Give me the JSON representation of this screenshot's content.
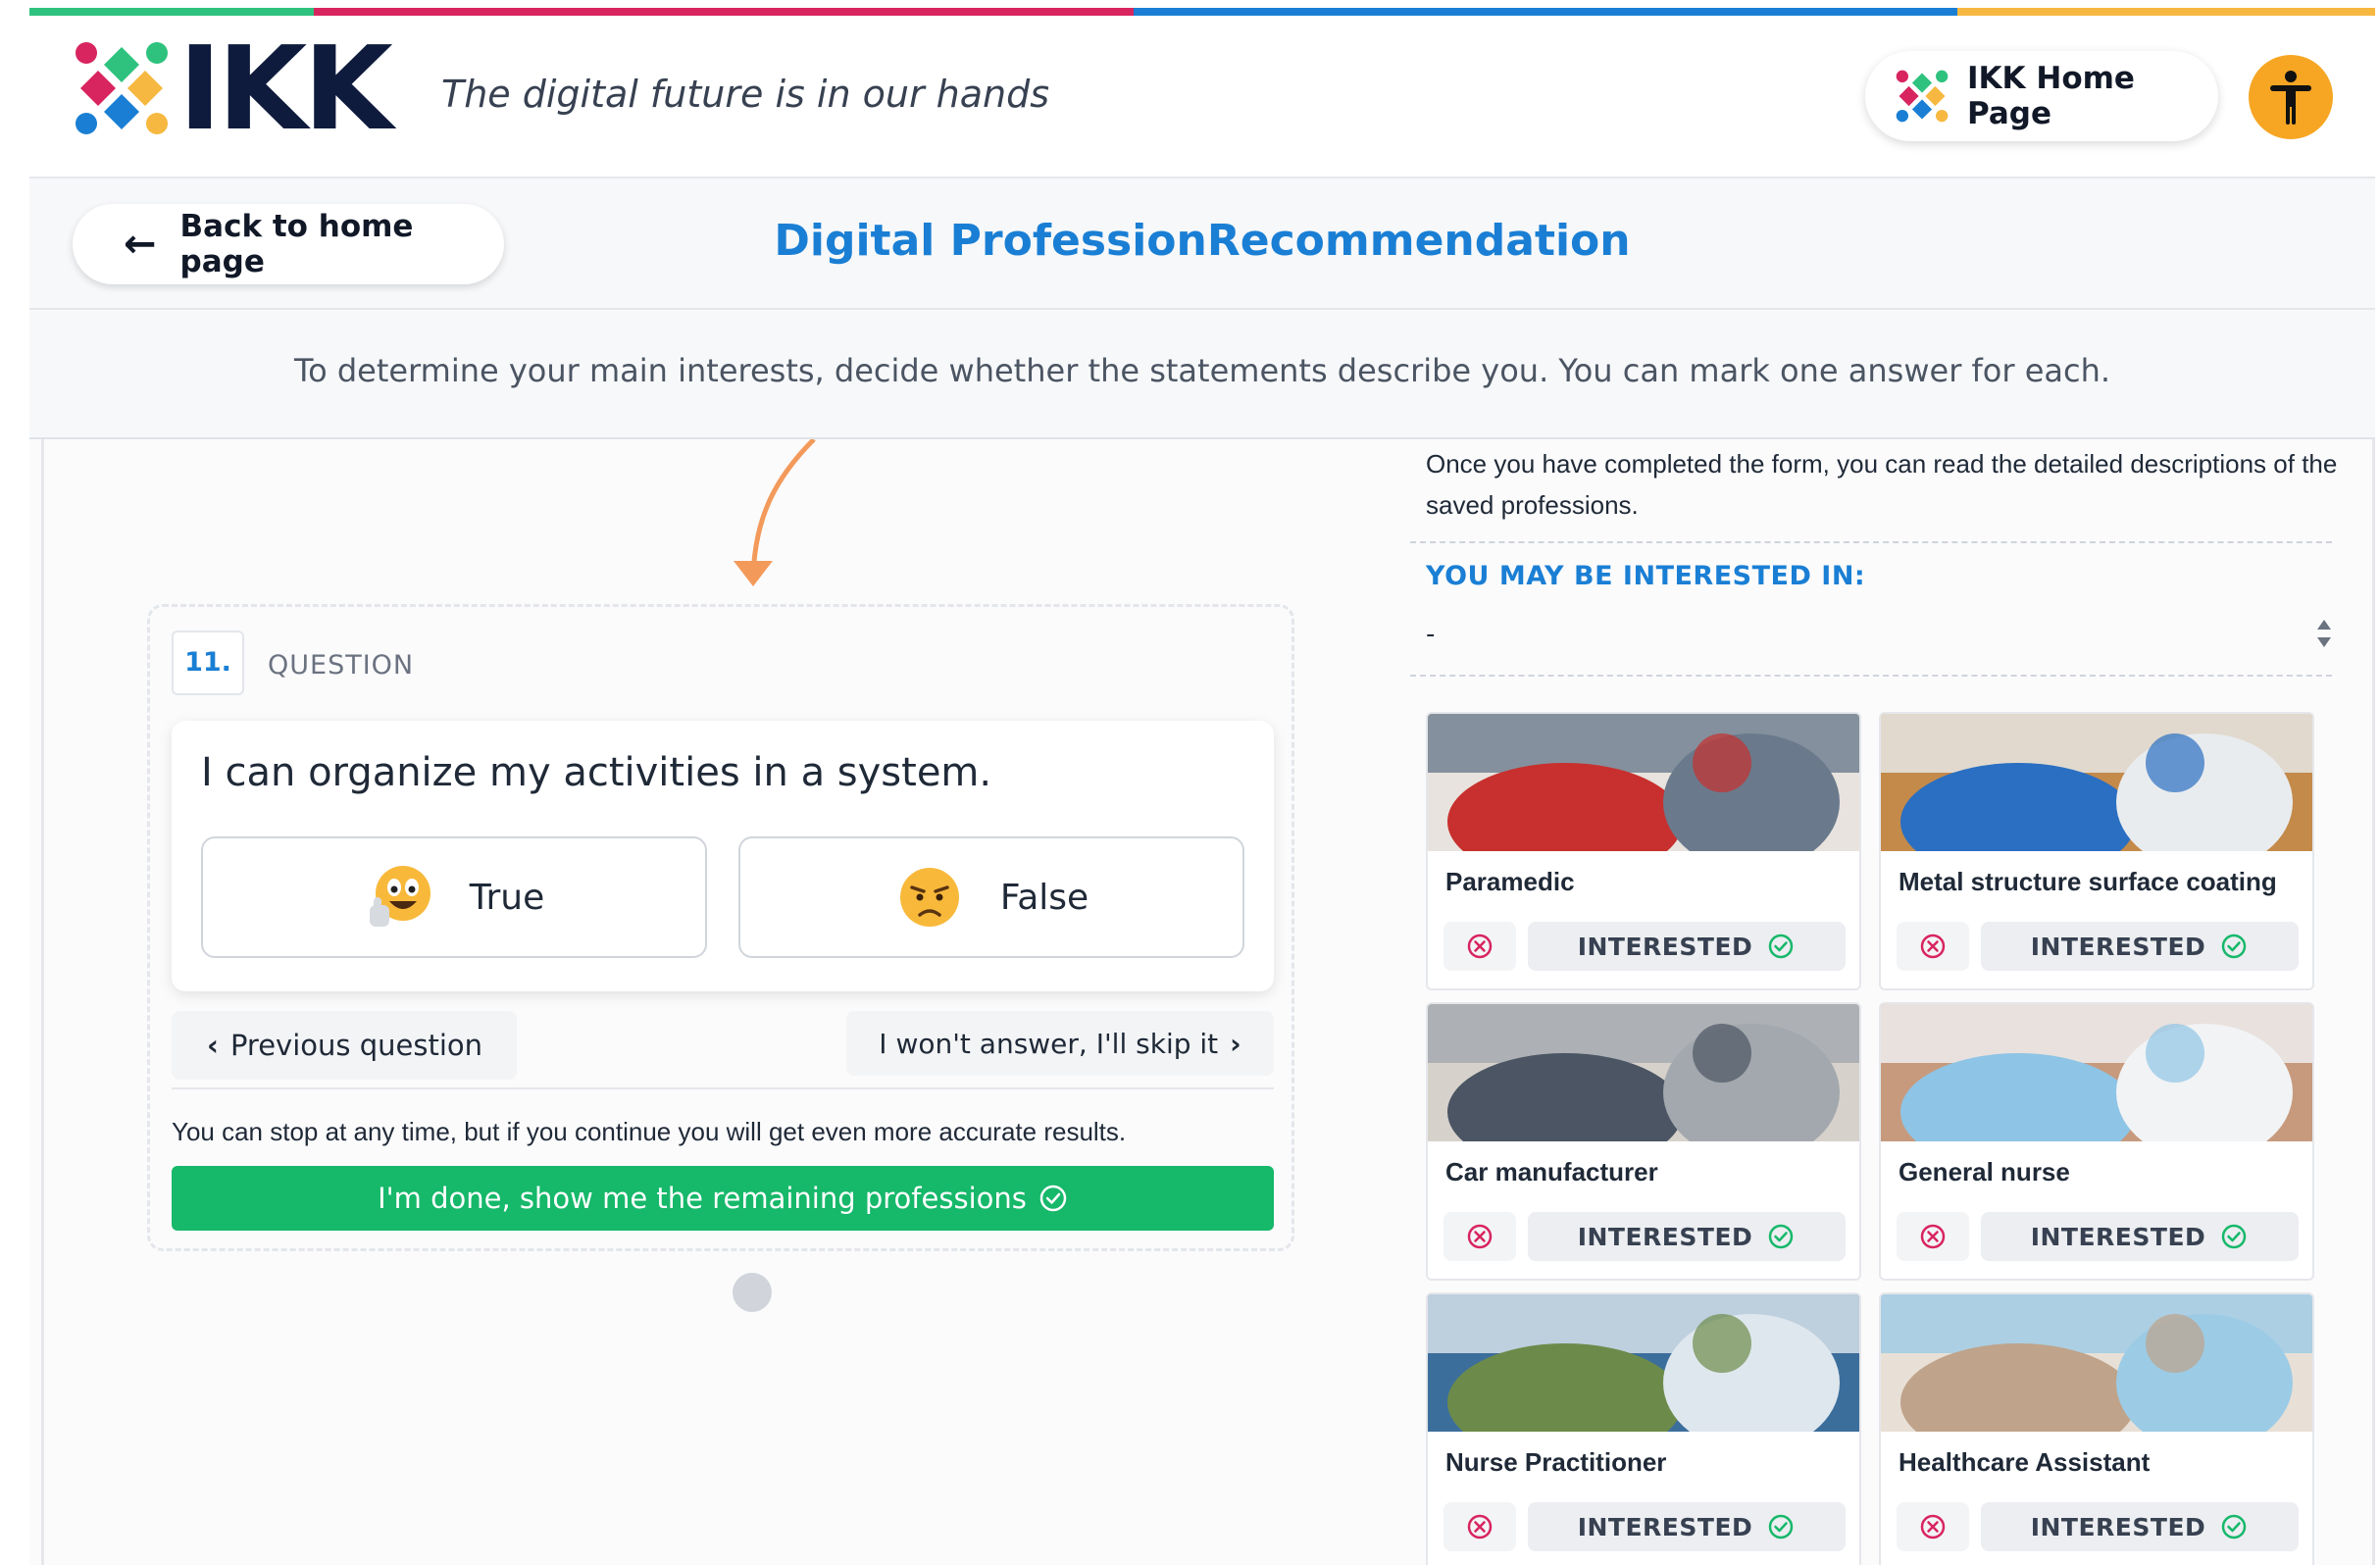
{
  "brand": {
    "name": "IKK",
    "tagline": "The digital future is in our hands",
    "strip_colors": [
      "#2ec27e",
      "#d8245f",
      "#1a7fd4",
      "#f6b840"
    ]
  },
  "header": {
    "home_button_label": "IKK Home Page",
    "accessibility_icon": "accessibility-icon"
  },
  "titlebar": {
    "back_label": "Back to home page",
    "page_title": "Digital ProfessionRecommendation"
  },
  "instruction": "To determine your main interests, decide whether the statements describe you. You can mark one answer for each.",
  "question": {
    "number": "11.",
    "label": "QUESTION",
    "text": "I can organize my activities in a system.",
    "answers": [
      {
        "label": "True",
        "icon": "thumbs-up-emoji-icon"
      },
      {
        "label": "False",
        "icon": "sad-emoji-icon"
      }
    ],
    "prev_label": "Previous question",
    "skip_label": "I won't answer, I'll skip it",
    "stop_text": "You can stop at any time, but if you continue you will get even more accurate results.",
    "done_label": "I'm done, show me the remaining professions"
  },
  "sidebar": {
    "info_text": "Once you have completed the form, you can read the detailed descriptions of the saved professions.",
    "interest_heading": "YOU MAY BE INTERESTED IN:",
    "select_value": "-",
    "interested_label": "INTERESTED",
    "professions": [
      {
        "name": "Paramedic",
        "photo_colors": [
          "#c7302e",
          "#6a7a8c",
          "#e8e3de"
        ]
      },
      {
        "name": "Metal structure surface coating",
        "photo_colors": [
          "#2a6fc2",
          "#e9ecef",
          "#c48a4a"
        ]
      },
      {
        "name": "Car manufacturer",
        "photo_colors": [
          "#4b5563",
          "#a3a8ae",
          "#d6d1cb"
        ]
      },
      {
        "name": "General nurse",
        "photo_colors": [
          "#8ec4e6",
          "#f1f3f5",
          "#c79a7e"
        ]
      },
      {
        "name": "Nurse Practitioner",
        "photo_colors": [
          "#6c8b4a",
          "#dfe7ee",
          "#3c6e9c"
        ]
      },
      {
        "name": "Healthcare Assistant",
        "photo_colors": [
          "#bfa38a",
          "#9ccbe6",
          "#e8e0d6"
        ]
      }
    ]
  }
}
